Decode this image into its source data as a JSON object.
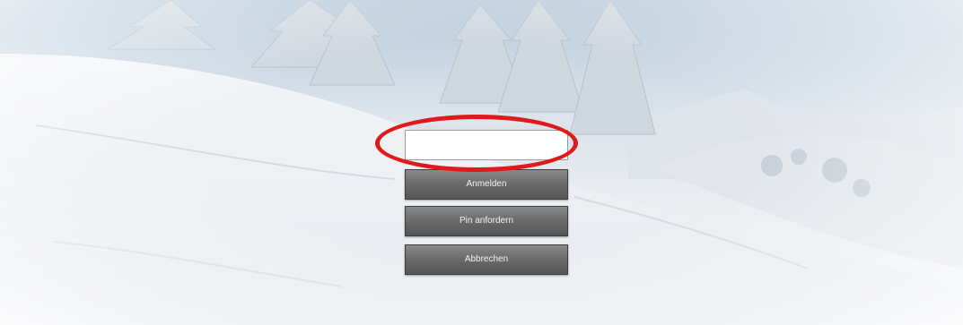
{
  "login_form": {
    "pin_input": {
      "value": "",
      "placeholder": ""
    },
    "buttons": {
      "login": "Anmelden",
      "request_pin": "Pin anfordern",
      "cancel": "Abbrechen"
    }
  },
  "annotation": {
    "highlight_color": "#e0191b"
  },
  "background": {
    "scene": "snowy-forest-hillside"
  }
}
